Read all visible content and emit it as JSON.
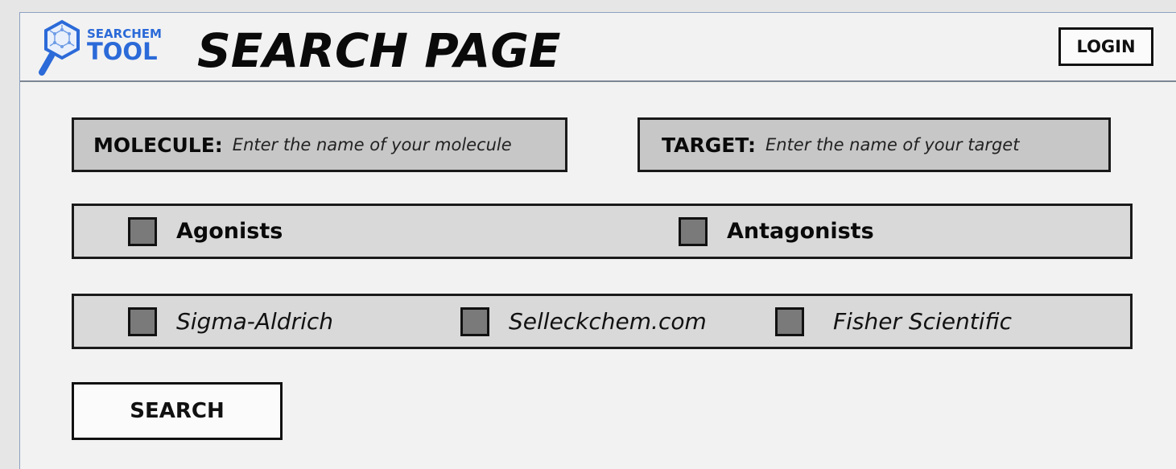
{
  "header": {
    "logo_line1": "SEARCHEM",
    "logo_line2": "TOOL",
    "title": "SEARCH PAGE",
    "login_label": "LOGIN"
  },
  "fields": {
    "molecule": {
      "label": "MOLECULE:",
      "placeholder": "Enter the name of your molecule",
      "value": ""
    },
    "target": {
      "label": "TARGET:",
      "placeholder": "Enter the name of your target",
      "value": ""
    }
  },
  "activity_filters": [
    {
      "label": "Agonists",
      "checked": false
    },
    {
      "label": "Antagonists",
      "checked": false
    }
  ],
  "supplier_filters": [
    {
      "label": "Sigma-Aldrich",
      "checked": false
    },
    {
      "label": "Selleckchem.com",
      "checked": false
    },
    {
      "label": "Fisher Scientific",
      "checked": false
    }
  ],
  "search_label": "SEARCH",
  "colors": {
    "logo_blue": "#2b6ad8",
    "field_fill": "#c7c7c7",
    "bar_fill": "#d9d9d9",
    "checkbox_fill": "#7a7a7a",
    "page_bg": "#f2f2f2"
  },
  "icons": {
    "logo": "molecule-magnifier-icon"
  }
}
